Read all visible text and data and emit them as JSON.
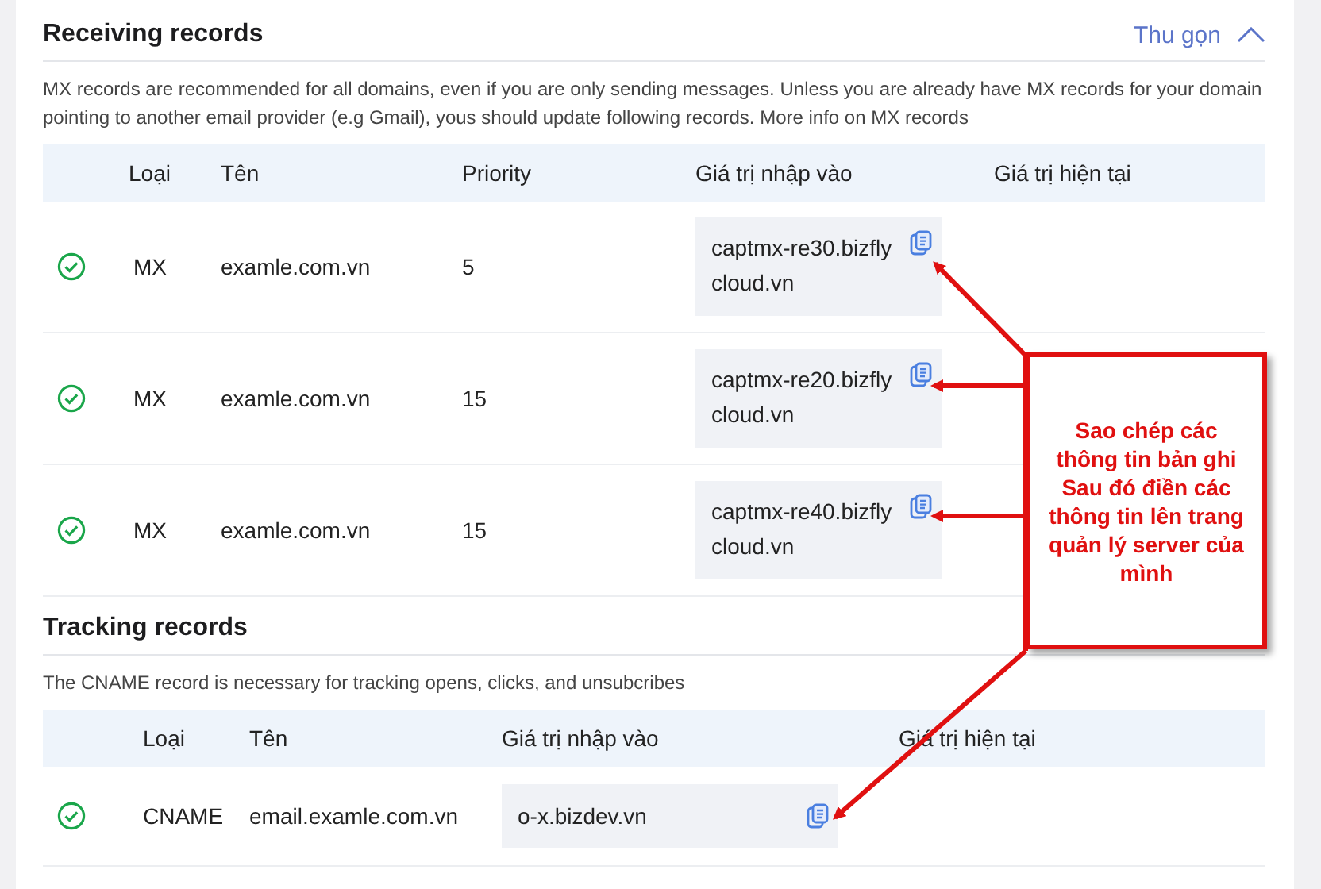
{
  "sections": [
    {
      "title": "Receiving records",
      "collapse": {
        "label": "Thu gọn",
        "expanded": true
      },
      "description": "MX records are recommended for all domains, even if you are only sending messages. Unless you are already have MX records for your domain pointing to another email provider (e.g Gmail), yous should update following records. More info on MX records",
      "columns": [
        "Loại",
        "Tên",
        "Priority",
        "Giá trị nhập vào",
        "Giá trị hiện tại"
      ],
      "rows": [
        {
          "verified": true,
          "type": "MX",
          "name": "examle.com.vn",
          "priority": "5",
          "value": "captmx-re30.bizfly cloud.vn"
        },
        {
          "verified": true,
          "type": "MX",
          "name": "examle.com.vn",
          "priority": "15",
          "value": "captmx-re20.bizfly cloud.vn"
        },
        {
          "verified": true,
          "type": "MX",
          "name": "examle.com.vn",
          "priority": "15",
          "value": "captmx-re40.bizfly cloud.vn"
        }
      ]
    },
    {
      "title": "Tracking records",
      "description": "The CNAME record is necessary for tracking opens, clicks, and unsubcribes",
      "columns": [
        "Loại",
        "Tên",
        "Giá trị nhập vào",
        "Giá trị hiện tại"
      ],
      "rows": [
        {
          "verified": true,
          "type": "CNAME",
          "name": "email.examle.com.vn",
          "value": "o-x.bizdev.vn"
        }
      ]
    }
  ],
  "callout": {
    "text": "Sao chép các thông tin bản ghi Sau đó điền các thông tin lên trang quản lý server của mình"
  }
}
